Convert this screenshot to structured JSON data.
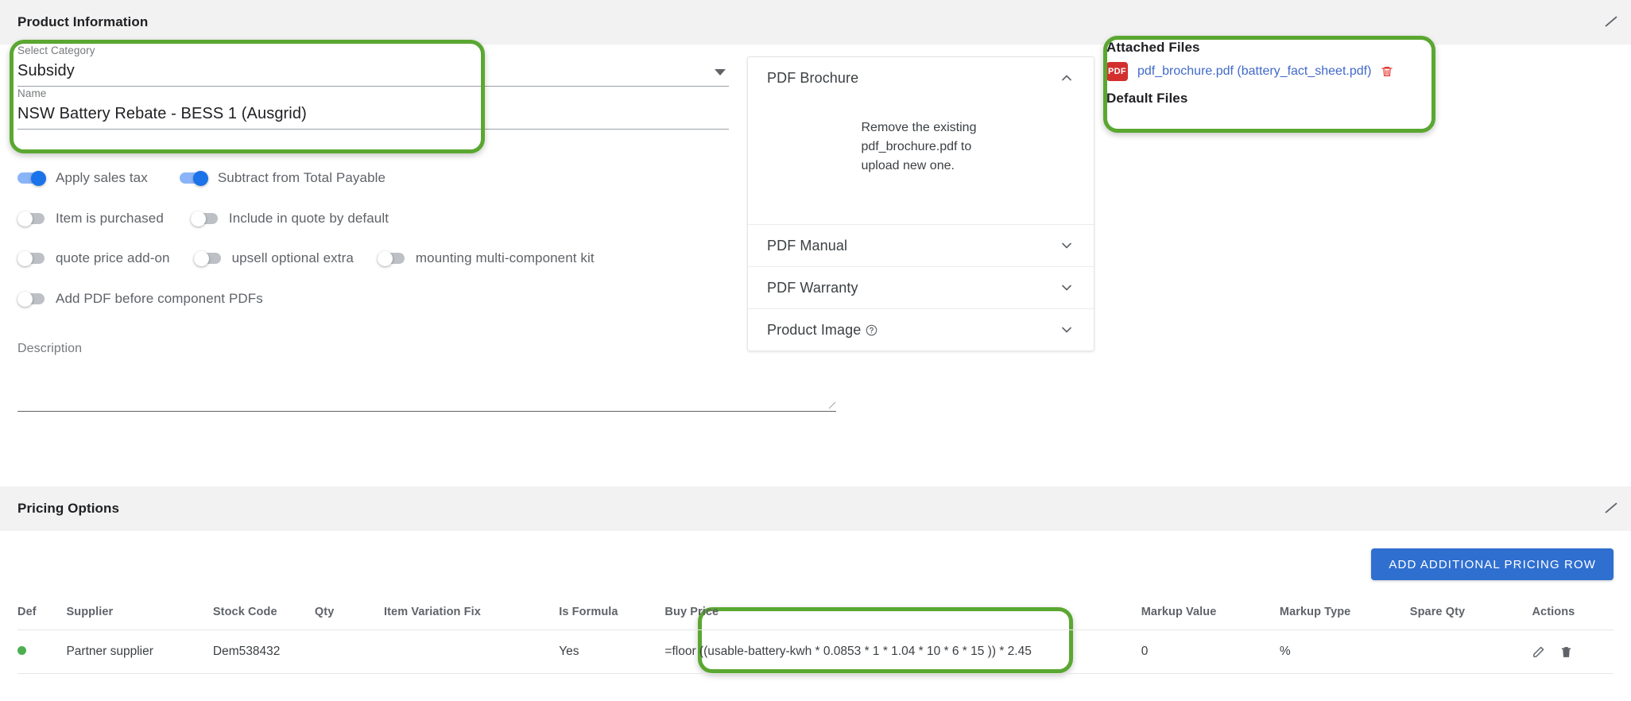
{
  "product_information": {
    "title": "Product Information",
    "collapse_icon": "chevron-collapse-icon",
    "category": {
      "label": "Select Category",
      "value": "Subsidy"
    },
    "name": {
      "label": "Name",
      "value": "NSW Battery Rebate - BESS 1 (Ausgrid)"
    },
    "toggles": [
      {
        "label": "Apply sales tax",
        "on": true
      },
      {
        "label": "Subtract from Total Payable",
        "on": true
      },
      {
        "label": "Item is purchased",
        "on": false
      },
      {
        "label": "Include in quote by default",
        "on": false
      },
      {
        "label": "quote price add-on",
        "on": false
      },
      {
        "label": "upsell optional extra",
        "on": false
      },
      {
        "label": "mounting multi-component kit",
        "on": false
      },
      {
        "label": "Add PDF before component PDFs",
        "on": false
      }
    ],
    "description": {
      "label": "Description",
      "value": ""
    }
  },
  "pdf_panel": {
    "sections": [
      {
        "title": "PDF Brochure",
        "expanded": true,
        "body": "Remove the existing pdf_brochure.pdf to upload new one."
      },
      {
        "title": "PDF Manual",
        "expanded": false
      },
      {
        "title": "PDF Warranty",
        "expanded": false
      },
      {
        "title": "Product Image",
        "expanded": false,
        "help": true
      }
    ]
  },
  "attached_files": {
    "title": "Attached Files",
    "files": [
      {
        "badge": "PDF",
        "name": "pdf_brochure.pdf (battery_fact_sheet.pdf)",
        "delete_icon": "trash-icon"
      }
    ],
    "default_files_title": "Default Files"
  },
  "pricing_options": {
    "title": "Pricing Options",
    "collapse_icon": "chevron-collapse-icon",
    "add_button": "ADD ADDITIONAL PRICING ROW",
    "columns": [
      "Def",
      "Supplier",
      "Stock Code",
      "Qty",
      "Item Variation Fix",
      "Is Formula",
      "Buy Price",
      "Markup Value",
      "Markup Type",
      "Spare Qty",
      "Actions"
    ],
    "rows": [
      {
        "def": "",
        "supplier": "Partner supplier",
        "stock_code": "Dem538432",
        "qty": "",
        "item_variation_fix": "",
        "is_formula": "Yes",
        "buy_price": "=floor ((usable-battery-kwh * 0.0853 * 1 * 1.04 * 10 * 6 * 15 )) * 2.45",
        "markup_value": "0",
        "markup_type": "%",
        "spare_qty": "",
        "actions": [
          "edit-icon",
          "delete-icon"
        ]
      }
    ]
  },
  "colors": {
    "highlight": "#5aa731",
    "toggle_on": "#1a73e8",
    "link": "#4169c9",
    "button": "#2f6fd0",
    "pdf_badge": "#d32f2f",
    "status_dot": "#4caf50"
  }
}
